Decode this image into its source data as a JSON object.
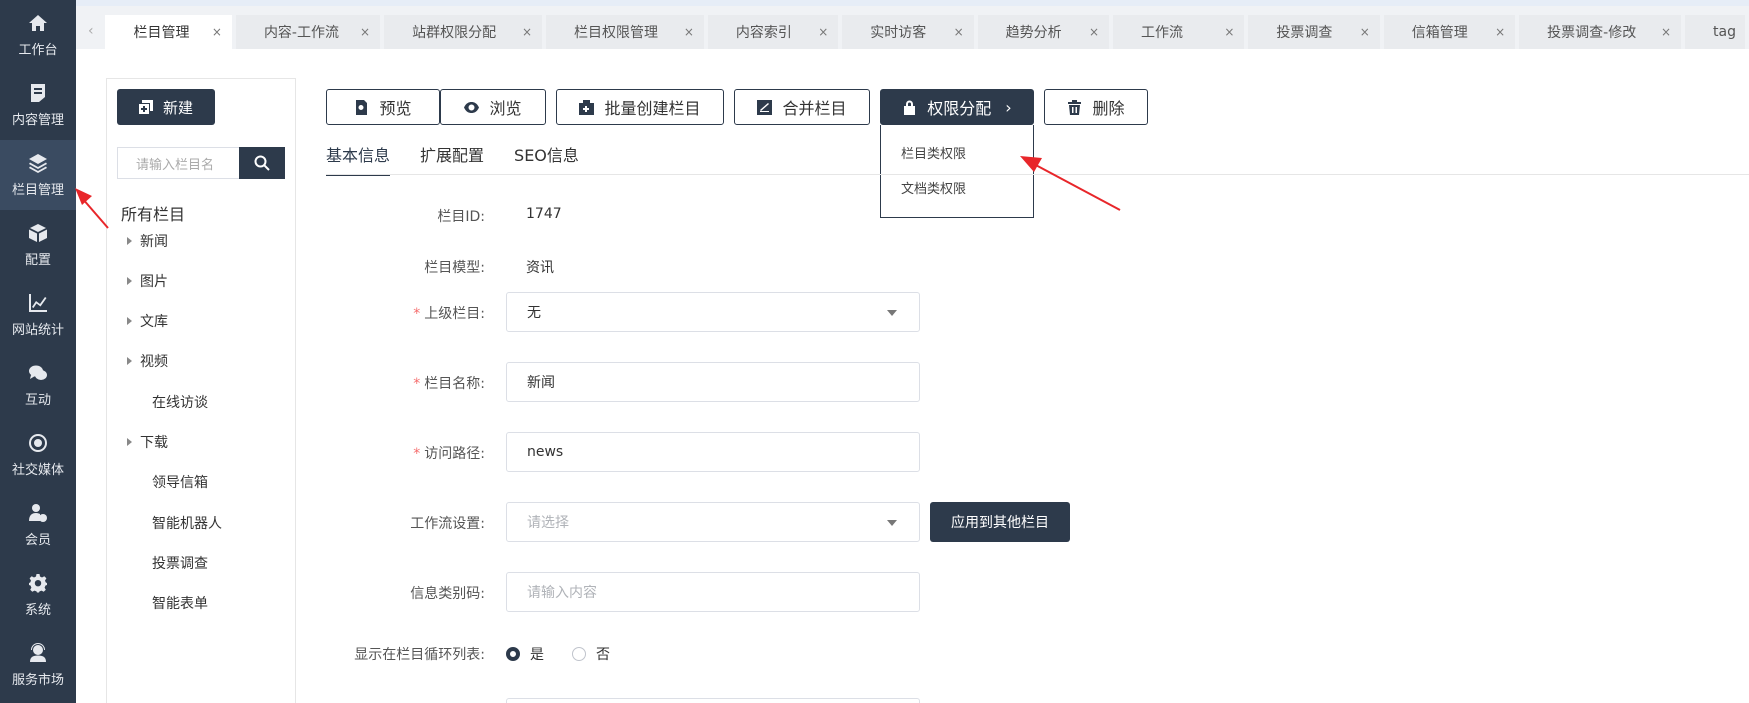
{
  "nav": [
    {
      "label": "工作台",
      "icon": "home-icon"
    },
    {
      "label": "内容管理",
      "icon": "document-icon"
    },
    {
      "label": "栏目管理",
      "icon": "layers-icon"
    },
    {
      "label": "配置",
      "icon": "cube-icon"
    },
    {
      "label": "网站统计",
      "icon": "line-chart-icon"
    },
    {
      "label": "互动",
      "icon": "chat-icon"
    },
    {
      "label": "社交媒体",
      "icon": "target-icon"
    },
    {
      "label": "会员",
      "icon": "user-check-icon"
    },
    {
      "label": "系统",
      "icon": "gear-icon"
    },
    {
      "label": "服务市场",
      "icon": "headset-icon"
    }
  ],
  "tabs": [
    {
      "label": "栏目管理"
    },
    {
      "label": "内容-工作流"
    },
    {
      "label": "站群权限分配"
    },
    {
      "label": "栏目权限管理"
    },
    {
      "label": "内容索引"
    },
    {
      "label": "实时访客"
    },
    {
      "label": "趋势分析"
    },
    {
      "label": "工作流"
    },
    {
      "label": "投票调查"
    },
    {
      "label": "信箱管理"
    },
    {
      "label": "投票调查-修改"
    },
    {
      "label": "tag"
    }
  ],
  "tab_close": "×",
  "scroll_left": "‹",
  "tree": {
    "new_label": "新建",
    "search_placeholder": "请输入栏目名",
    "title": "所有栏目",
    "nodes": [
      {
        "label": "新闻",
        "expandable": true
      },
      {
        "label": "图片",
        "expandable": true
      },
      {
        "label": "文库",
        "expandable": true
      },
      {
        "label": "视频",
        "expandable": true
      },
      {
        "label": "在线访谈",
        "expandable": false
      },
      {
        "label": "下载",
        "expandable": true
      },
      {
        "label": "领导信箱",
        "expandable": false
      },
      {
        "label": "智能机器人",
        "expandable": false
      },
      {
        "label": "投票调查",
        "expandable": false
      },
      {
        "label": "智能表单",
        "expandable": false
      }
    ]
  },
  "toolbar": {
    "preview": "预览",
    "browse": "浏览",
    "batch_create": "批量创建栏目",
    "merge": "合并栏目",
    "permission": "权限分配",
    "permission_chevron": "›",
    "delete": "删除"
  },
  "permission_menu": [
    "栏目类权限",
    "文档类权限"
  ],
  "subtabs": [
    "基本信息",
    "扩展配置",
    "SEO信息"
  ],
  "form": {
    "column_id_label": "栏目ID:",
    "column_id": "1747",
    "model_label": "栏目模型:",
    "model": "资讯",
    "parent_label": "上级栏目:",
    "parent": "无",
    "name_label": "栏目名称:",
    "name": "新闻",
    "path_label": "访问路径:",
    "path": "news",
    "workflow_label": "工作流设置:",
    "workflow_placeholder": "请选择",
    "apply_label": "应用到其他栏目",
    "code_label": "信息类别码:",
    "code_placeholder": "请输入内容",
    "show_label": "显示在栏目循环列表:",
    "yes": "是",
    "no": "否",
    "required_mark": "*"
  },
  "colors": {
    "accent": "#2d3a4b",
    "annotation_arrow": "#e8262a"
  }
}
